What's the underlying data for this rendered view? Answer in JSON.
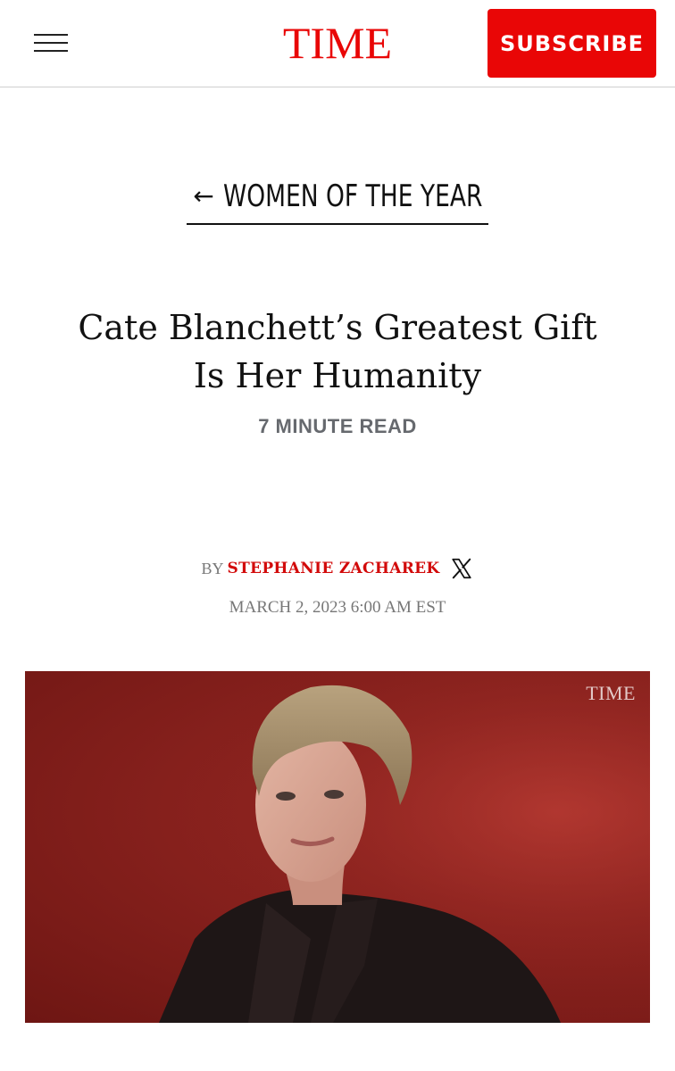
{
  "header": {
    "logo": "TIME",
    "subscribe_label": "SUBSCRIBE",
    "menu_icon": "hamburger-menu-icon"
  },
  "section": {
    "arrow": "←",
    "label": "WOMEN OF THE YEAR"
  },
  "article": {
    "headline_line1": "Cate Blanchett’s Greatest Gift",
    "headline_line2": "Is Her Humanity",
    "read_time": "7 MINUTE READ",
    "by": "BY",
    "author": "STEPHANIE ZACHAREK",
    "author_social_icon": "x-logo-icon",
    "date": "MARCH 2, 2023 6:00 AM EST"
  },
  "media": {
    "watermark": "TIME"
  },
  "colors": {
    "brand_red": "#e90606",
    "author_red": "#d20a0a",
    "muted_gray": "#777777",
    "read_time_gray": "#66696e",
    "backdrop_red": "#8f2420"
  }
}
